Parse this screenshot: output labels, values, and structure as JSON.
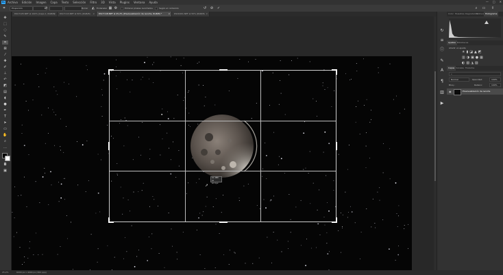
{
  "menu": [
    "Archivo",
    "Edición",
    "Imagen",
    "Capa",
    "Texto",
    "Selección",
    "Filtro",
    "3D",
    "Vista",
    "Plugins",
    "Ventana",
    "Ayuda"
  ],
  "options": {
    "ratio_label": "Proporción",
    "clear_label": "Borrar",
    "straighten_label": "Enderezar",
    "delete_cropped_label": "Eliminar píxeles recortados",
    "content_aware_label": "Según el contenido"
  },
  "tabs": [
    {
      "label": "DSC7125.NEF al 100% (Capa 1, RGB/8)",
      "active": false
    },
    {
      "label": "DSC7113.NEF al 50% (RGB/8)",
      "active": false
    },
    {
      "label": "DSC7118.NEF al 25,2% (Previsualización de recorte, RGB/8) *",
      "active": true
    },
    {
      "label": "DSC6491.NEF al 50% (RGB/8)",
      "active": false
    }
  ],
  "crop_readout": {
    "width": "An: 980 px",
    "height": "Al: 0 px"
  },
  "status": {
    "zoom": "25,2%",
    "doc": "6000 px x 4000 px (300 ppp)"
  },
  "panels": {
    "top_tabs": [
      "Color",
      "Muestras",
      "Degradados",
      "Motivos",
      "Histograma"
    ],
    "adjustments_tabs": [
      "Ajustes",
      "Bibliotecas"
    ],
    "adjustments_title": "Añadir un ajuste",
    "layers_tabs": [
      "Capas",
      "Canales",
      "Trazados"
    ],
    "blend_mode": "Normal",
    "opacity_label": "Opacidad:",
    "opacity_value": "100%",
    "lock_label": "Bloq.:",
    "fill_label": "Relleno:",
    "fill_value": "100%",
    "layer_name": "Previsualización de recorte"
  },
  "colors": {
    "accent": "#31a8ff",
    "canvas": "#050505",
    "chrome": "#323232"
  }
}
